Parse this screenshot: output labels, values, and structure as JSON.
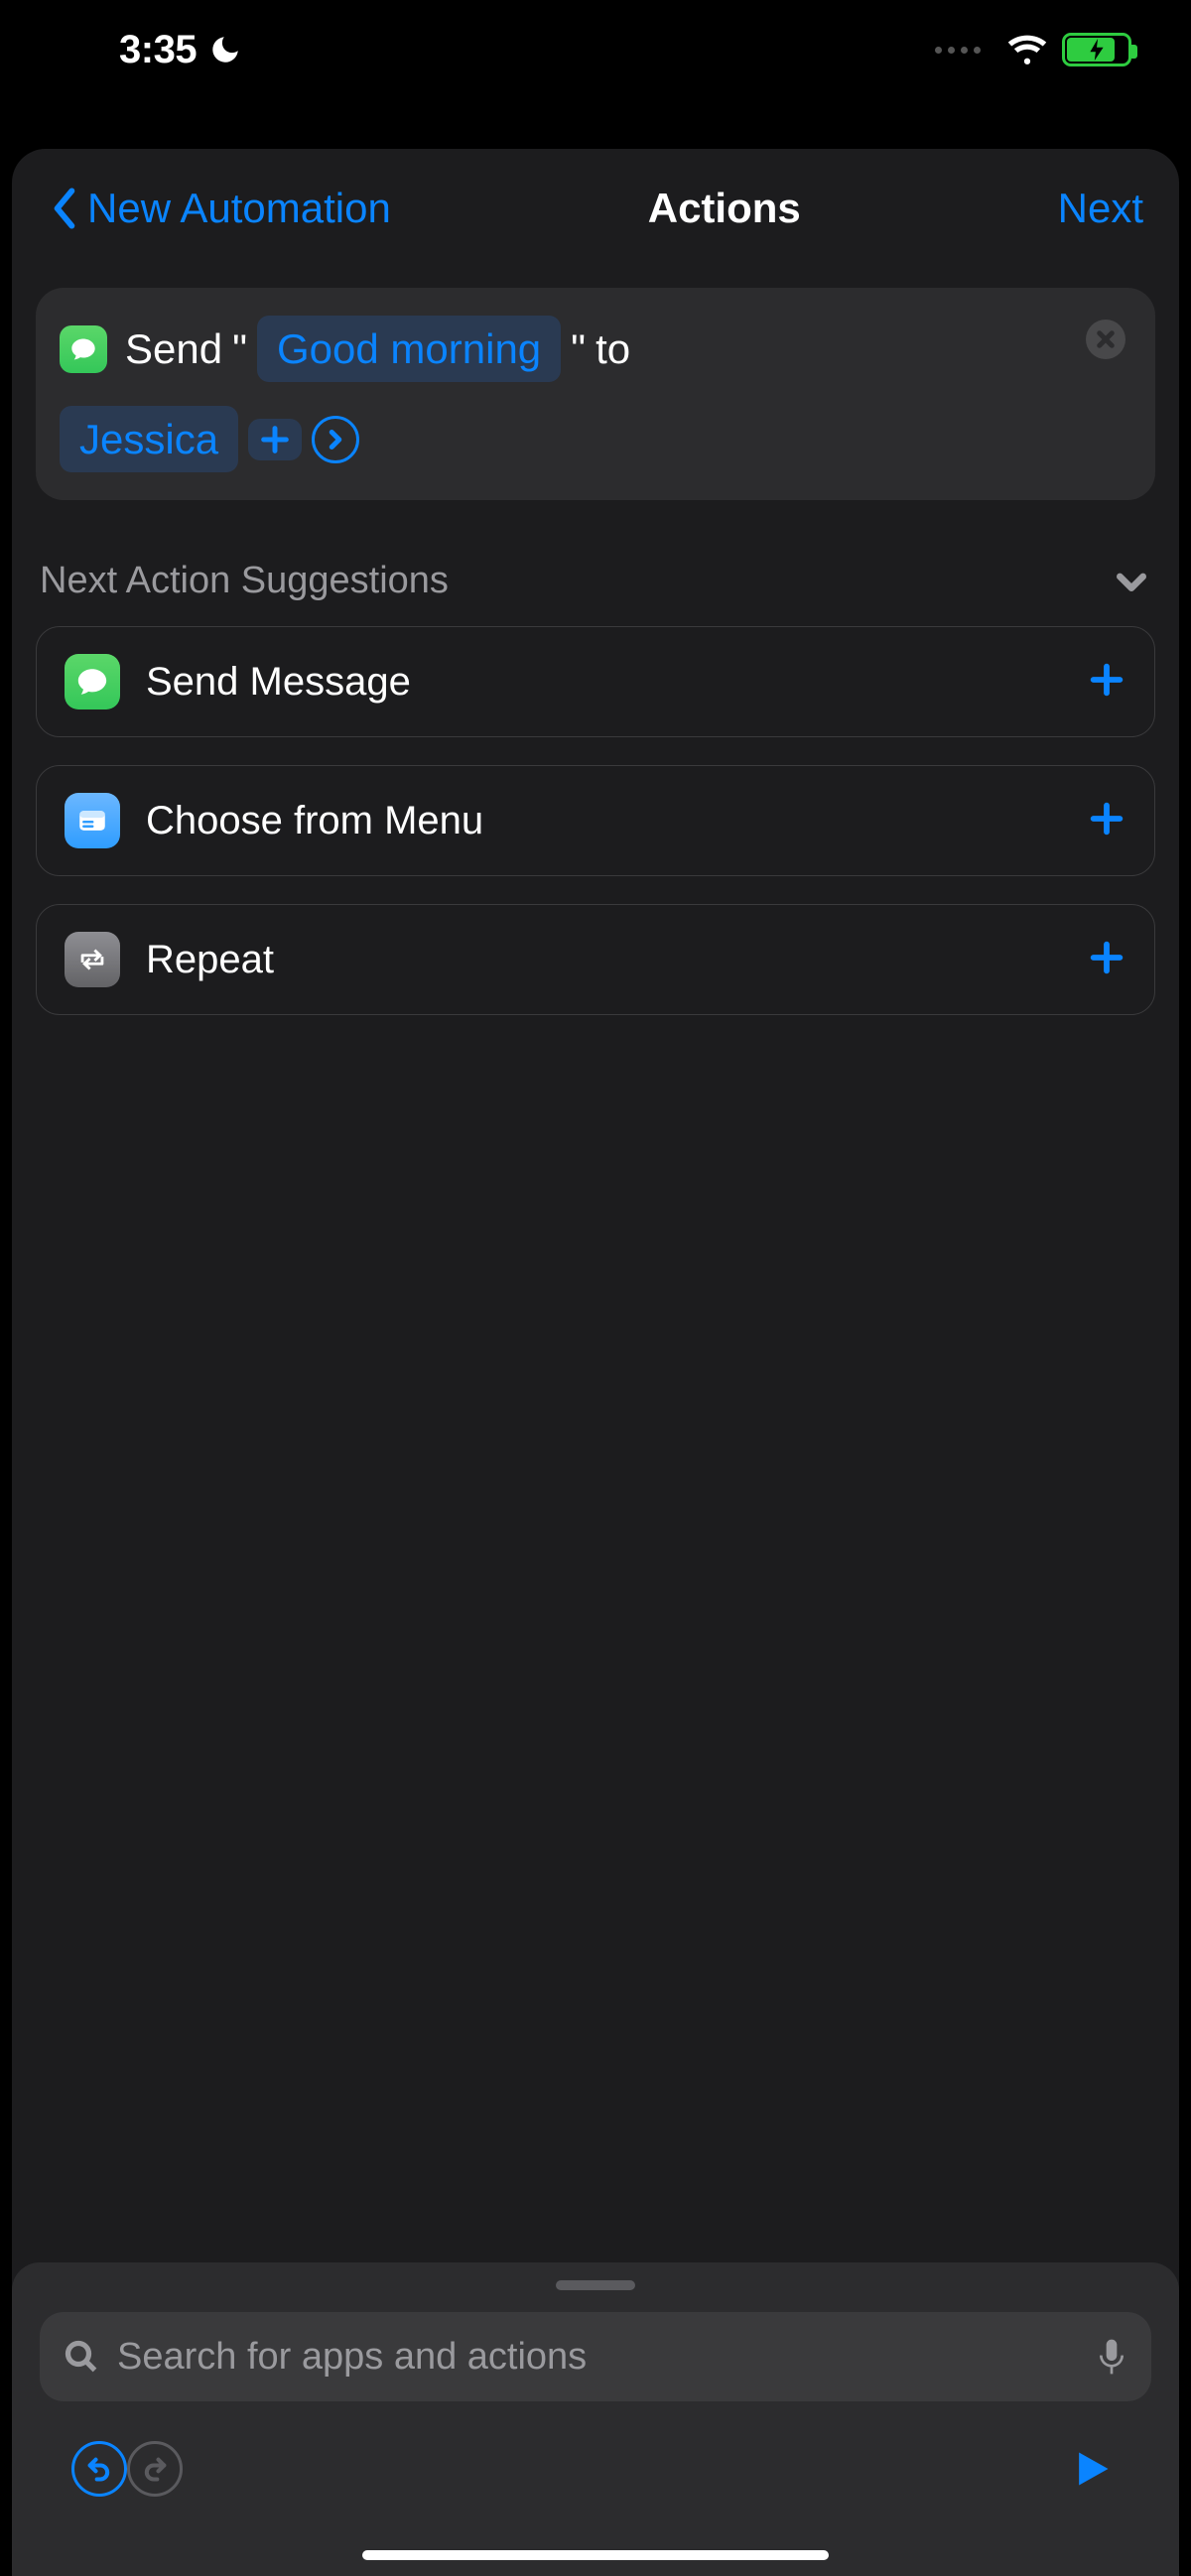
{
  "status": {
    "time": "3:35"
  },
  "nav": {
    "back_label": "New Automation",
    "title": "Actions",
    "next_label": "Next"
  },
  "action": {
    "word_send": "Send",
    "quote_open": "\"",
    "message_token": "Good morning",
    "quote_close": "\"",
    "word_to": "to",
    "recipient_token": "Jessica"
  },
  "suggestions_header": "Next Action Suggestions",
  "suggestions": [
    {
      "label": "Send Message",
      "icon": "messages"
    },
    {
      "label": "Choose from Menu",
      "icon": "menu"
    },
    {
      "label": "Repeat",
      "icon": "repeat"
    }
  ],
  "search": {
    "placeholder": "Search for apps and actions"
  }
}
